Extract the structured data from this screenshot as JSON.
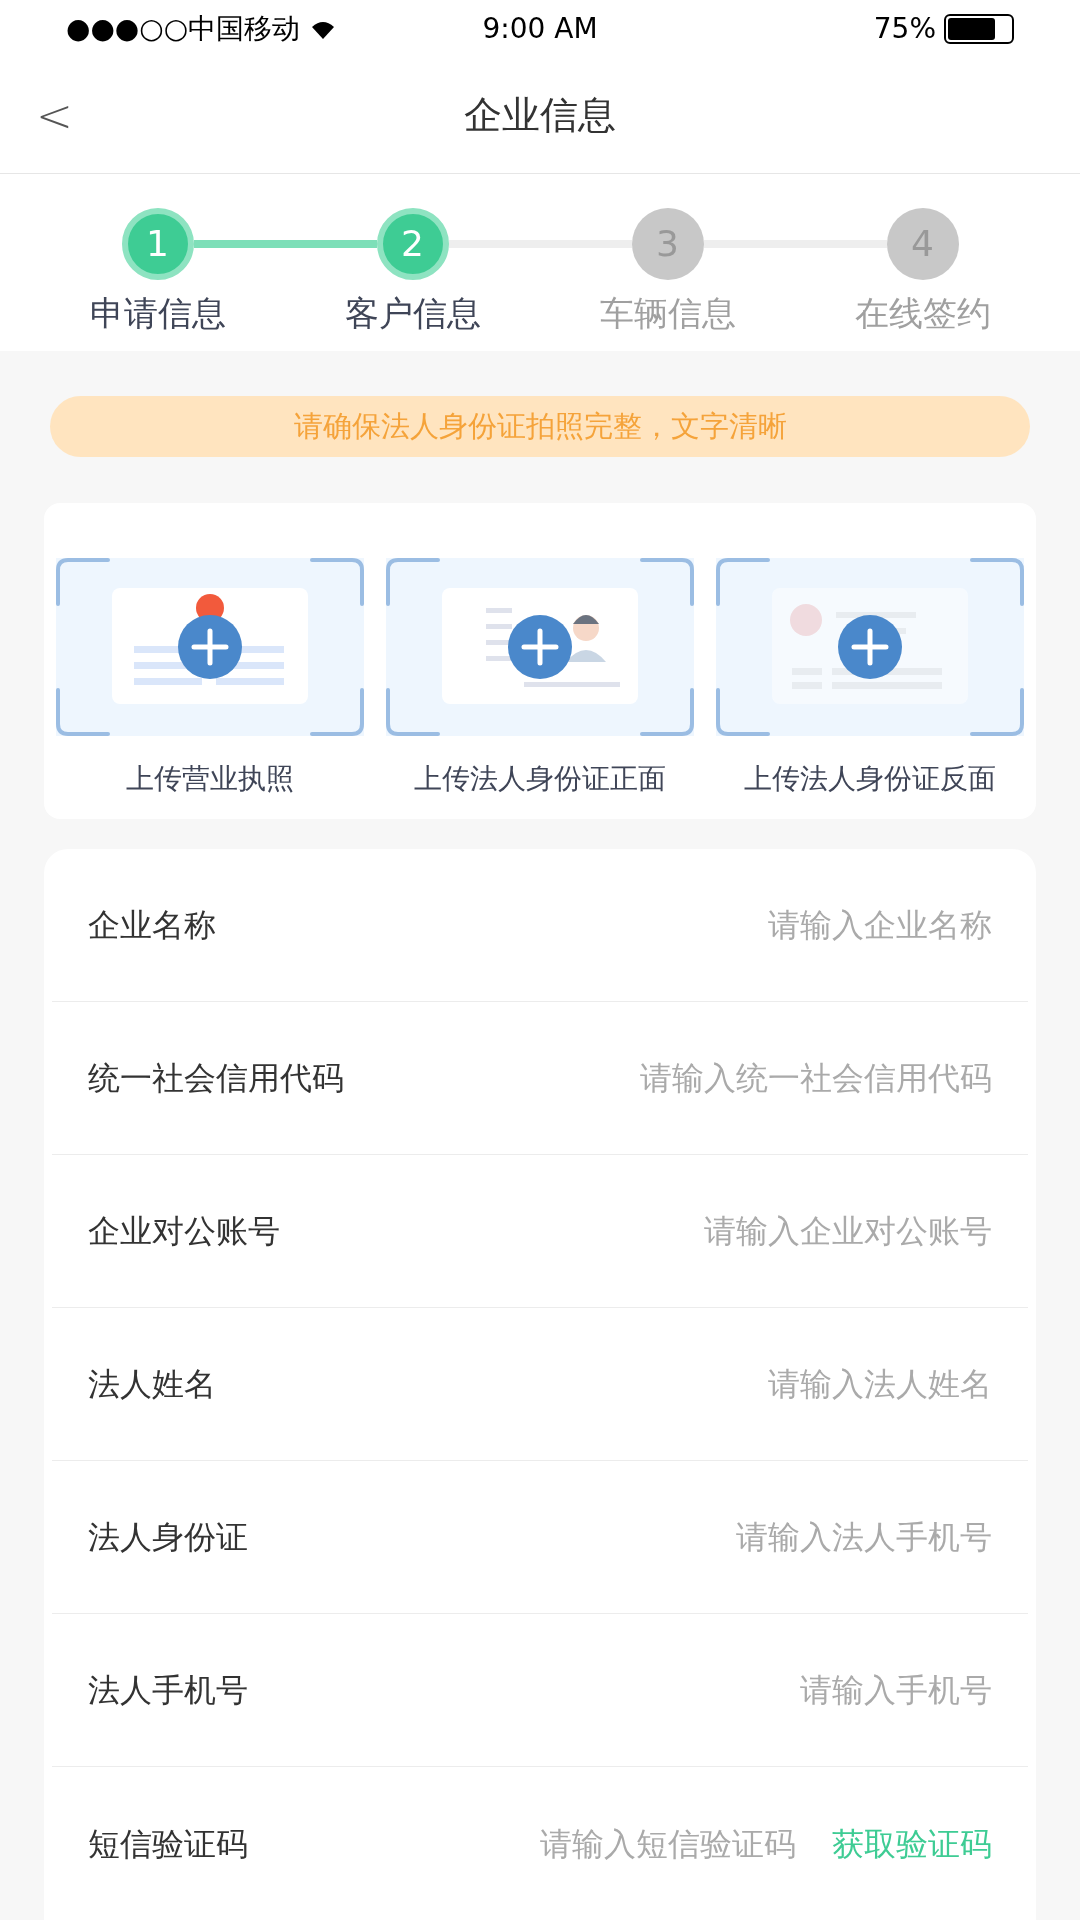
{
  "status_bar": {
    "carrier": "●●●○○中国移动",
    "time": "9:00 AM",
    "battery": "75%"
  },
  "nav": {
    "back": "<",
    "title": "企业信息"
  },
  "steps": [
    {
      "number": "1",
      "label": "申请信息",
      "completed": true
    },
    {
      "number": "2",
      "label": "客户信息",
      "completed": true
    },
    {
      "number": "3",
      "label": "车辆信息",
      "completed": false
    },
    {
      "number": "4",
      "label": "在线签约",
      "completed": false
    }
  ],
  "notice": "请确保法人身份证拍照完整，文字清晰",
  "uploads": [
    {
      "kind": "license",
      "label": "上传营业执照"
    },
    {
      "kind": "id_front",
      "label": "上传法人身份证正面"
    },
    {
      "kind": "id_back",
      "label": "上传法人身份证反面"
    }
  ],
  "form": [
    {
      "label": "企业名称",
      "placeholder": "请输入企业名称"
    },
    {
      "label": "统一社会信用代码",
      "placeholder": "请输入统一社会信用代码"
    },
    {
      "label": "企业对公账号",
      "placeholder": "请输入企业对公账号"
    },
    {
      "label": "法人姓名",
      "placeholder": "请输入法人姓名"
    },
    {
      "label": "法人身份证",
      "placeholder": "请输入法人手机号"
    },
    {
      "label": "法人手机号",
      "placeholder": "请输入手机号"
    },
    {
      "label": "短信验证码",
      "placeholder": "请输入短信验证码",
      "action": "获取验证码"
    }
  ]
}
